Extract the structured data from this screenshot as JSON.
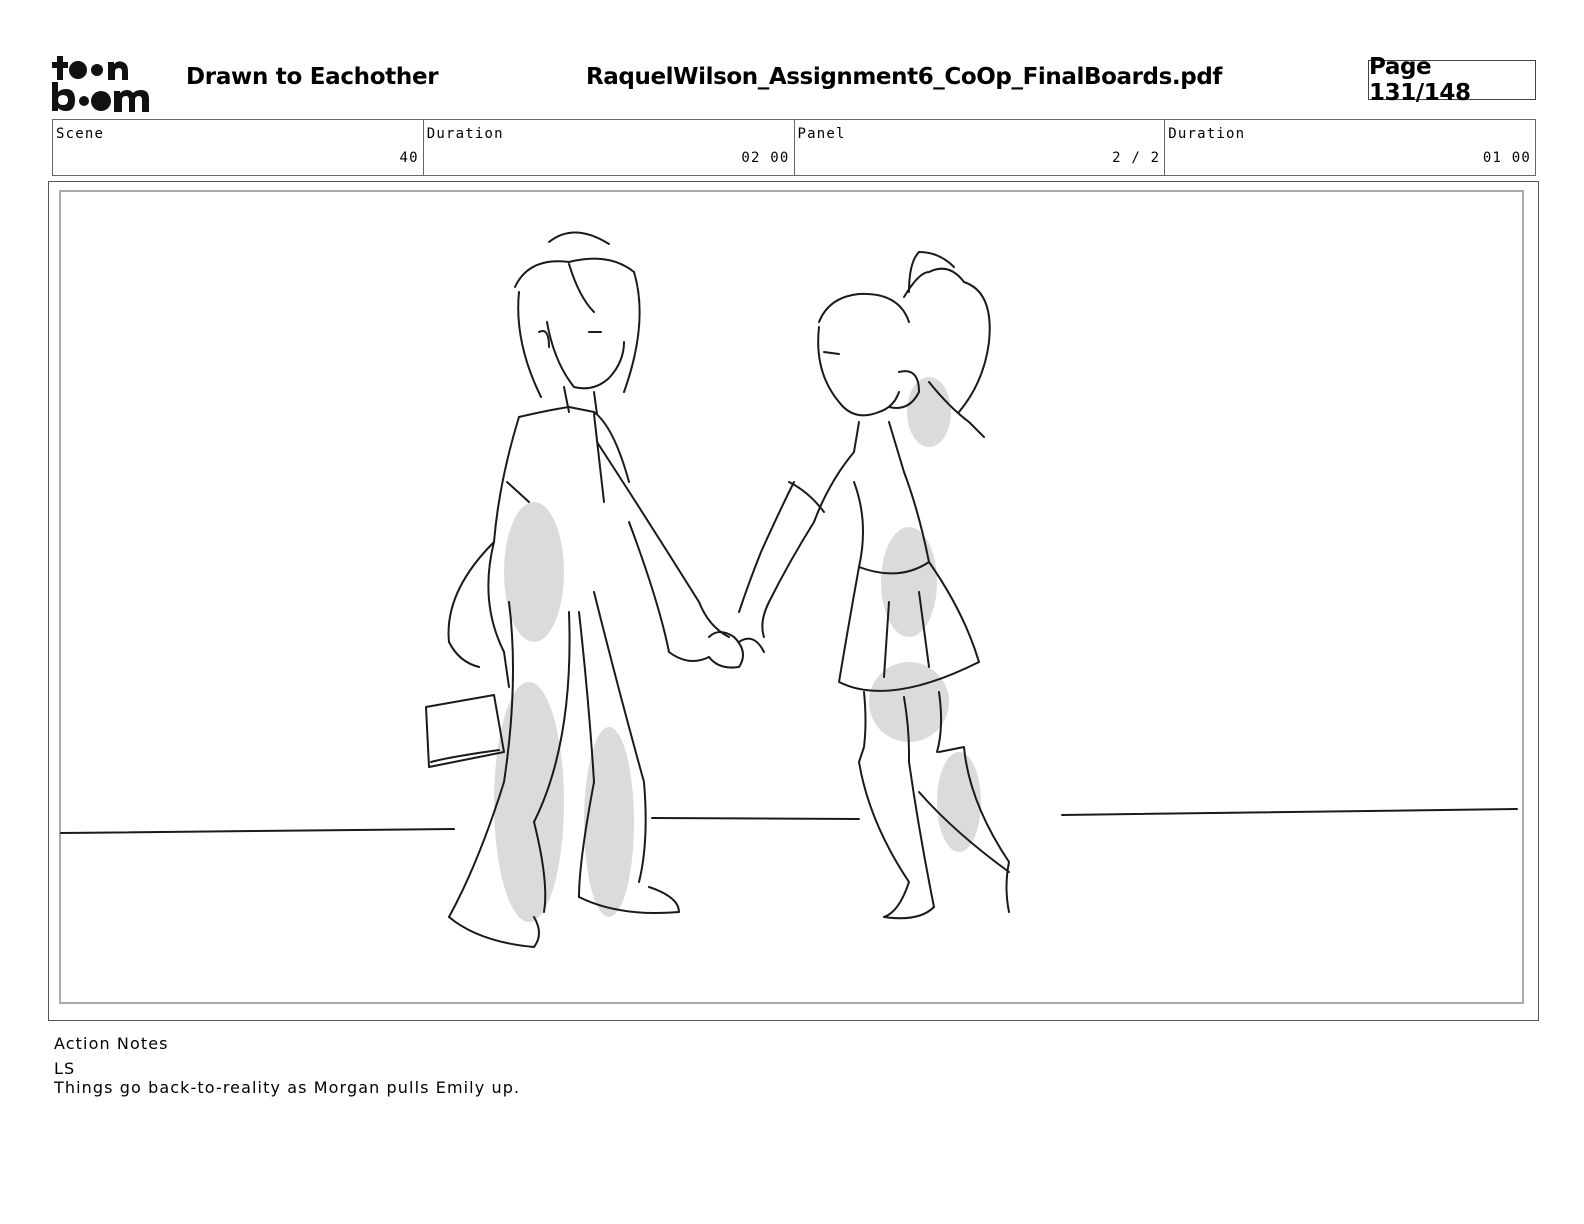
{
  "header": {
    "logo_text": "toon boom",
    "project_title": "Drawn to Eachother",
    "file_name": "RaquelWilson_Assignment6_CoOp_FinalBoards.pdf",
    "page_indicator": "Page 131/148"
  },
  "meta": {
    "scene_label": "Scene",
    "scene_value": "40",
    "scene_duration_label": "Duration",
    "scene_duration_value": "02 00",
    "panel_label": "Panel",
    "panel_value": "2 / 2",
    "panel_duration_label": "Duration",
    "panel_duration_value": "01 00"
  },
  "panel": {
    "image_description_icon": "storyboard-sketch-icon"
  },
  "notes": {
    "heading": "Action Notes",
    "lines": [
      "LS",
      "Things go back-to-reality as Morgan pulls Emily up."
    ]
  },
  "colors": {
    "ink": "#1a1a1a",
    "shading": "#cfcfcf",
    "frame": "#aaaaaa"
  }
}
